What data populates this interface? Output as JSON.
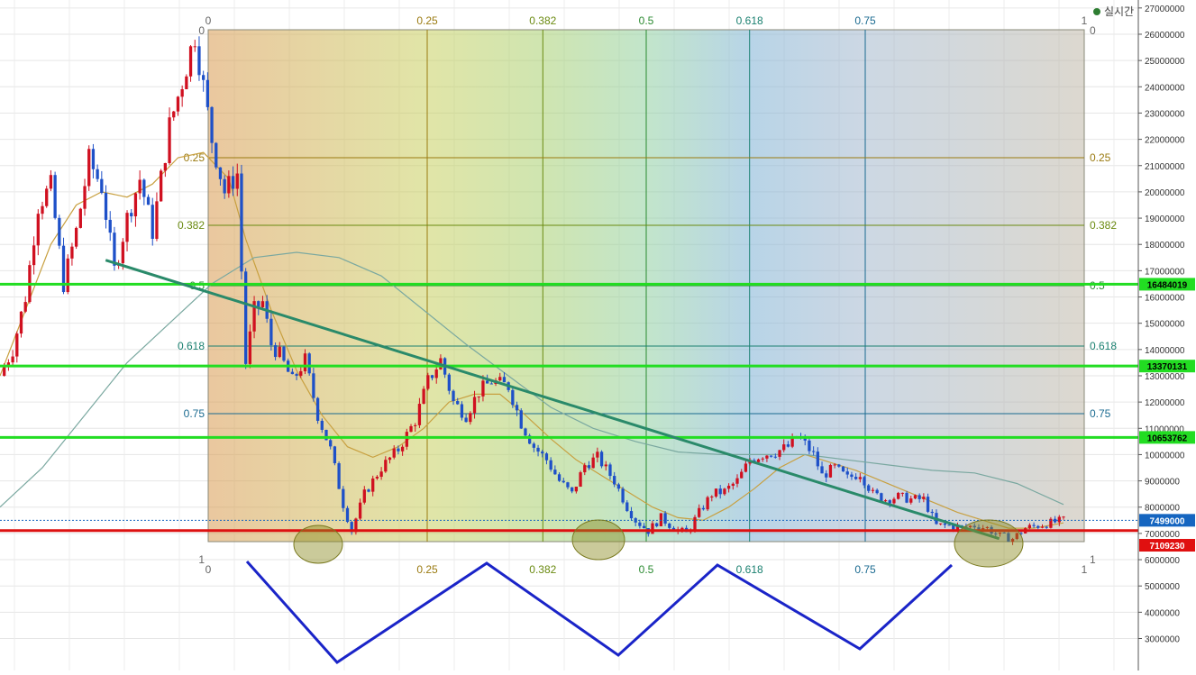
{
  "legend": {
    "realtime_label": "실시간",
    "color": "#2e7d32"
  },
  "chart_data": {
    "type": "candlestick",
    "title": "",
    "y_ticks": [
      3000000,
      4000000,
      5000000,
      6000000,
      7000000,
      8000000,
      9000000,
      10000000,
      11000000,
      12000000,
      13000000,
      14000000,
      15000000,
      16000000,
      17000000,
      18000000,
      19000000,
      20000000,
      21000000,
      22000000,
      23000000,
      24000000,
      25000000,
      26000000,
      27000000
    ],
    "ylim": [
      2400000,
      27200000
    ],
    "grid": true,
    "fib_time_levels": [
      {
        "label": "0",
        "value": 0
      },
      {
        "label": "0.25",
        "value": 0.25
      },
      {
        "label": "0.382",
        "value": 0.382
      },
      {
        "label": "0.5",
        "value": 0.5
      },
      {
        "label": "0.618",
        "value": 0.618
      },
      {
        "label": "0.75",
        "value": 0.75
      },
      {
        "label": "1",
        "value": 1
      }
    ],
    "fib_price_levels": [
      {
        "label": "0",
        "value": 0
      },
      {
        "label": "0.25",
        "value": 0.25
      },
      {
        "label": "0.382",
        "value": 0.382
      },
      {
        "label": "0.5",
        "value": 0.5
      },
      {
        "label": "0.618",
        "value": 0.618
      },
      {
        "label": "0.75",
        "value": 0.75
      },
      {
        "label": "1",
        "value": 1
      }
    ],
    "fib_price_range": [
      26000000,
      6600000
    ],
    "horizontal_lines": [
      {
        "label": "16484019",
        "value": 16484019,
        "color": "#22dd22"
      },
      {
        "label": "13370131",
        "value": 13370131,
        "color": "#22dd22"
      },
      {
        "label": "10653762",
        "value": 10653762,
        "color": "#22dd22"
      },
      {
        "label": "7109230",
        "value": 7109230,
        "color": "#dd1111"
      }
    ],
    "current_price": {
      "label": "7499000",
      "value": 7499000,
      "color": "#1565c0"
    },
    "up_color": "#d01020",
    "down_color": "#1e50c8",
    "candle_close_path": [
      [
        0,
        13000000
      ],
      [
        3,
        14000000
      ],
      [
        6,
        16000000
      ],
      [
        9,
        19500000
      ],
      [
        12,
        20200000
      ],
      [
        15,
        16500000
      ],
      [
        18,
        18500000
      ],
      [
        21,
        21200000
      ],
      [
        24,
        20200000
      ],
      [
        27,
        17000000
      ],
      [
        30,
        19000000
      ],
      [
        33,
        20500000
      ],
      [
        36,
        18500000
      ],
      [
        40,
        22500000
      ],
      [
        43,
        24200000
      ],
      [
        46,
        26000000
      ],
      [
        50,
        22000000
      ],
      [
        53,
        20000000
      ],
      [
        56,
        20700000
      ],
      [
        57,
        17000000
      ],
      [
        58,
        13500000
      ],
      [
        60,
        15500000
      ],
      [
        62,
        15800000
      ],
      [
        64,
        14200000
      ],
      [
        66,
        13800000
      ],
      [
        69,
        12800000
      ],
      [
        72,
        13600000
      ],
      [
        75,
        11500000
      ],
      [
        78,
        10200000
      ],
      [
        81,
        8100000
      ],
      [
        83,
        7100000
      ],
      [
        86,
        8500000
      ],
      [
        90,
        9500000
      ],
      [
        94,
        10200000
      ],
      [
        98,
        11300000
      ],
      [
        101,
        12800000
      ],
      [
        104,
        13600000
      ],
      [
        107,
        12000000
      ],
      [
        110,
        11500000
      ],
      [
        113,
        12400000
      ],
      [
        116,
        12800000
      ],
      [
        120,
        12600000
      ],
      [
        123,
        11200000
      ],
      [
        126,
        10300000
      ],
      [
        129,
        9800000
      ],
      [
        132,
        9000000
      ],
      [
        135,
        8500000
      ],
      [
        138,
        9600000
      ],
      [
        141,
        9900000
      ],
      [
        145,
        9000000
      ],
      [
        148,
        8000000
      ],
      [
        150,
        7500000
      ],
      [
        153,
        7100000
      ],
      [
        156,
        7600000
      ],
      [
        159,
        7200000
      ],
      [
        162,
        7000000
      ],
      [
        165,
        7800000
      ],
      [
        168,
        8500000
      ],
      [
        171,
        8600000
      ],
      [
        174,
        9000000
      ],
      [
        177,
        9800000
      ],
      [
        180,
        10000000
      ],
      [
        183,
        10100000
      ],
      [
        186,
        10300000
      ],
      [
        188,
        10700000
      ],
      [
        190,
        10400000
      ],
      [
        192,
        10000000
      ],
      [
        194,
        9200000
      ],
      [
        197,
        9500000
      ],
      [
        200,
        9100000
      ],
      [
        203,
        9300000
      ],
      [
        206,
        8500000
      ],
      [
        209,
        8300000
      ],
      [
        212,
        8400000
      ],
      [
        215,
        8300000
      ],
      [
        218,
        8300000
      ],
      [
        221,
        7300000
      ],
      [
        224,
        7300000
      ],
      [
        227,
        7200000
      ],
      [
        230,
        7300000
      ],
      [
        233,
        7200000
      ],
      [
        236,
        6900000
      ],
      [
        239,
        6800000
      ],
      [
        242,
        7200000
      ],
      [
        245,
        7300000
      ],
      [
        248,
        7400000
      ],
      [
        251,
        7499000
      ]
    ],
    "x_count": 251,
    "moving_averages": [
      {
        "color": "#c8a040",
        "points": [
          [
            0,
            13000000
          ],
          [
            6,
            15500000
          ],
          [
            12,
            18000000
          ],
          [
            18,
            19500000
          ],
          [
            24,
            20000000
          ],
          [
            30,
            19800000
          ],
          [
            36,
            20300000
          ],
          [
            42,
            21300000
          ],
          [
            48,
            21500000
          ],
          [
            54,
            20500000
          ],
          [
            58,
            18200000
          ],
          [
            64,
            15500000
          ],
          [
            70,
            13200000
          ],
          [
            76,
            11500000
          ],
          [
            82,
            10300000
          ],
          [
            88,
            9900000
          ],
          [
            94,
            10300000
          ],
          [
            100,
            11000000
          ],
          [
            106,
            12000000
          ],
          [
            112,
            12300000
          ],
          [
            118,
            12300000
          ],
          [
            124,
            11500000
          ],
          [
            130,
            10600000
          ],
          [
            136,
            9800000
          ],
          [
            142,
            9200000
          ],
          [
            148,
            8600000
          ],
          [
            154,
            8000000
          ],
          [
            160,
            7600000
          ],
          [
            166,
            7500000
          ],
          [
            172,
            8000000
          ],
          [
            178,
            8700000
          ],
          [
            184,
            9500000
          ],
          [
            190,
            10000000
          ],
          [
            196,
            9700000
          ],
          [
            202,
            9400000
          ],
          [
            208,
            9000000
          ],
          [
            214,
            8600000
          ],
          [
            220,
            8200000
          ],
          [
            226,
            7800000
          ],
          [
            232,
            7500000
          ],
          [
            238,
            7200000
          ],
          [
            244,
            7200000
          ],
          [
            251,
            7400000
          ]
        ]
      },
      {
        "color": "#7aa8a0",
        "points": [
          [
            0,
            8000000
          ],
          [
            10,
            9500000
          ],
          [
            20,
            11500000
          ],
          [
            30,
            13500000
          ],
          [
            40,
            15000000
          ],
          [
            50,
            16500000
          ],
          [
            60,
            17500000
          ],
          [
            70,
            17700000
          ],
          [
            80,
            17500000
          ],
          [
            90,
            16800000
          ],
          [
            100,
            15500000
          ],
          [
            110,
            14200000
          ],
          [
            120,
            13000000
          ],
          [
            130,
            11800000
          ],
          [
            140,
            11000000
          ],
          [
            150,
            10500000
          ],
          [
            160,
            10100000
          ],
          [
            170,
            10000000
          ],
          [
            180,
            10000000
          ],
          [
            190,
            10000000
          ],
          [
            200,
            9800000
          ],
          [
            210,
            9600000
          ],
          [
            220,
            9400000
          ],
          [
            230,
            9300000
          ],
          [
            240,
            8900000
          ],
          [
            251,
            8100000
          ]
        ]
      }
    ],
    "trendline": {
      "points": [
        [
          16,
          17400000
        ],
        [
          239,
          6800000
        ]
      ],
      "color": "#2a8a6a"
    },
    "highlight_ellipses": [
      {
        "x": 83,
        "y": 6600000
      },
      {
        "x": 158,
        "y": 6900000
      },
      {
        "x": 236,
        "y": 6900000
      }
    ],
    "wave": {
      "points": [
        [
          16,
          6400000
        ],
        [
          48,
          2700000
        ],
        [
          120,
          6400000
        ],
        [
          169,
          2900000
        ],
        [
          219,
          6400000
        ],
        [
          270,
          3000000
        ],
        [
          310,
          6400000
        ]
      ],
      "color": "#1a24c8"
    }
  }
}
